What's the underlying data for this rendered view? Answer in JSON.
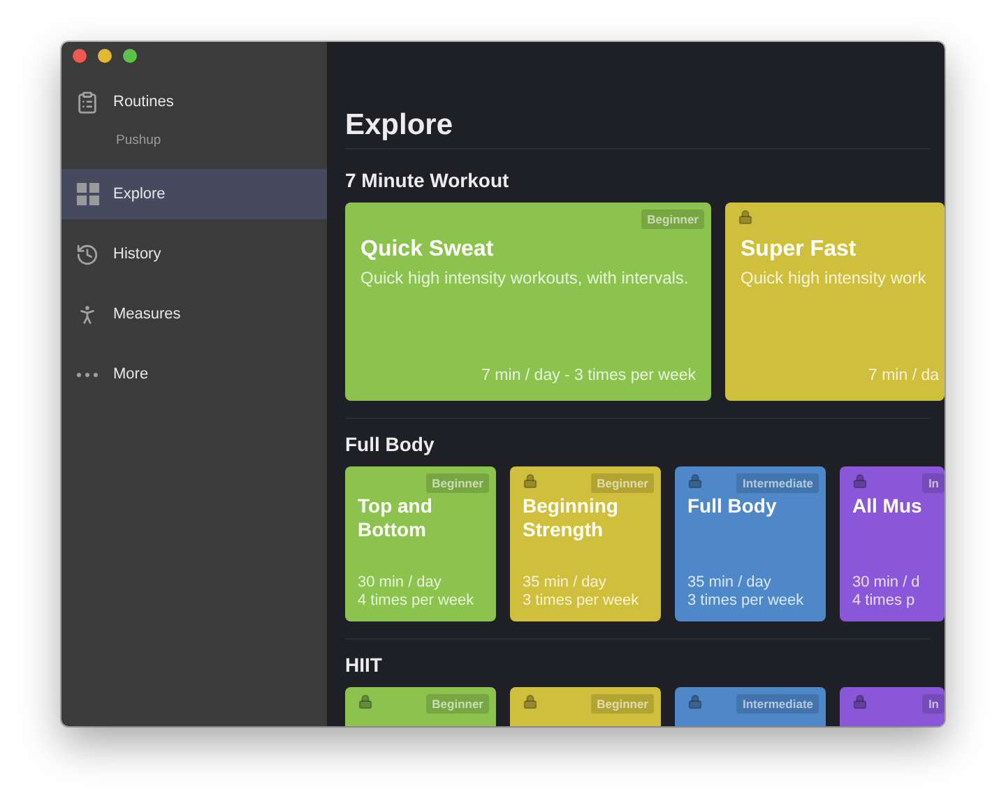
{
  "sidebar": {
    "items": [
      {
        "label": "Routines",
        "kind": "clipboard",
        "selected": false,
        "children": [
          {
            "label": "Pushup",
            "selected": false
          }
        ]
      },
      {
        "label": "Explore",
        "kind": "grid",
        "selected": true
      },
      {
        "label": "History",
        "kind": "clock",
        "selected": false
      },
      {
        "label": "Measures",
        "kind": "person",
        "selected": false
      },
      {
        "label": "More",
        "kind": "dots",
        "selected": false
      }
    ]
  },
  "page": {
    "title": "Explore"
  },
  "sections": [
    {
      "title": "7 Minute Workout",
      "kind": "wide",
      "cards": [
        {
          "title": "Quick Sweat",
          "description": "Quick high intensity workouts, with intervals.",
          "schedule": [
            "7 min / day - 3 times per week"
          ],
          "badge": "Beginner",
          "locked": false,
          "color": "#8cc24e"
        },
        {
          "title": "Super Fast",
          "description": "Quick high intensity work",
          "schedule": [
            "7 min / da"
          ],
          "locked": true,
          "color": "#d0bf3c"
        }
      ]
    },
    {
      "title": "Full Body",
      "kind": "tile",
      "cards": [
        {
          "title": "Top and Bottom",
          "schedule": [
            "30 min / day",
            "4 times per week"
          ],
          "badge": "Beginner",
          "locked": false,
          "color": "#8cc24e"
        },
        {
          "title": "Beginning Strength",
          "schedule": [
            "35 min / day",
            "3 times per week"
          ],
          "badge": "Beginner",
          "locked": true,
          "color": "#d0bf3c"
        },
        {
          "title": "Full Body",
          "schedule": [
            "35 min / day",
            "3 times per week"
          ],
          "badge": "Intermediate",
          "locked": true,
          "color": "#4e88c8"
        },
        {
          "title": "All Mus",
          "schedule": [
            "30 min / d",
            "4 times p"
          ],
          "badge": "In",
          "locked": true,
          "color": "#8a57d8"
        }
      ]
    },
    {
      "title": "HIIT",
      "kind": "tile",
      "cards": [
        {
          "badge": "Beginner",
          "locked": true,
          "color": "#8cc24e"
        },
        {
          "badge": "Beginner",
          "locked": true,
          "color": "#d0bf3c"
        },
        {
          "badge": "Intermediate",
          "locked": true,
          "color": "#4e88c8"
        },
        {
          "badge": "In",
          "locked": true,
          "color": "#8a57d8"
        }
      ]
    }
  ]
}
